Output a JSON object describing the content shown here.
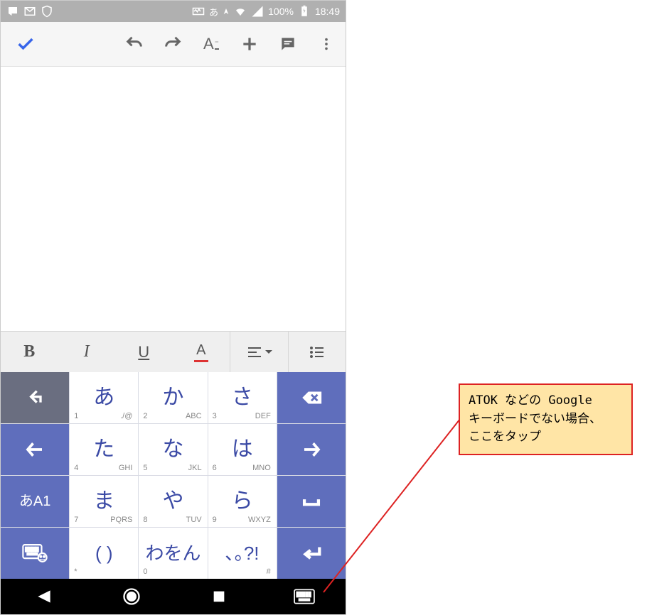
{
  "status": {
    "battery": "100%",
    "time": "18:49",
    "ime_badge": "あ"
  },
  "fmt": {
    "bold": "B",
    "italic": "I",
    "underline": "U",
    "color": "A"
  },
  "keys": {
    "r1c2": {
      "main": "あ",
      "num": "1",
      "alt": "./@"
    },
    "r1c3": {
      "main": "か",
      "num": "2",
      "alt": "ABC"
    },
    "r1c4": {
      "main": "さ",
      "num": "3",
      "alt": "DEF"
    },
    "r2c2": {
      "main": "た",
      "num": "4",
      "alt": "GHI"
    },
    "r2c3": {
      "main": "な",
      "num": "5",
      "alt": "JKL"
    },
    "r2c4": {
      "main": "は",
      "num": "6",
      "alt": "MNO"
    },
    "r3c1": "あA1",
    "r3c2": {
      "main": "ま",
      "num": "7",
      "alt": "PQRS"
    },
    "r3c3": {
      "main": "や",
      "num": "8",
      "alt": "TUV"
    },
    "r3c4": {
      "main": "ら",
      "num": "9",
      "alt": "WXYZ"
    },
    "r4c2": {
      "main": "( )",
      "num": "*"
    },
    "r4c3": {
      "main": "わをん",
      "num": "0"
    },
    "r4c4": {
      "main": "､｡?!",
      "alt": "#"
    }
  },
  "callout": {
    "line1": "ATOK などの Google",
    "line2": "キーボードでない場合、",
    "line3": "ここをタップ"
  }
}
